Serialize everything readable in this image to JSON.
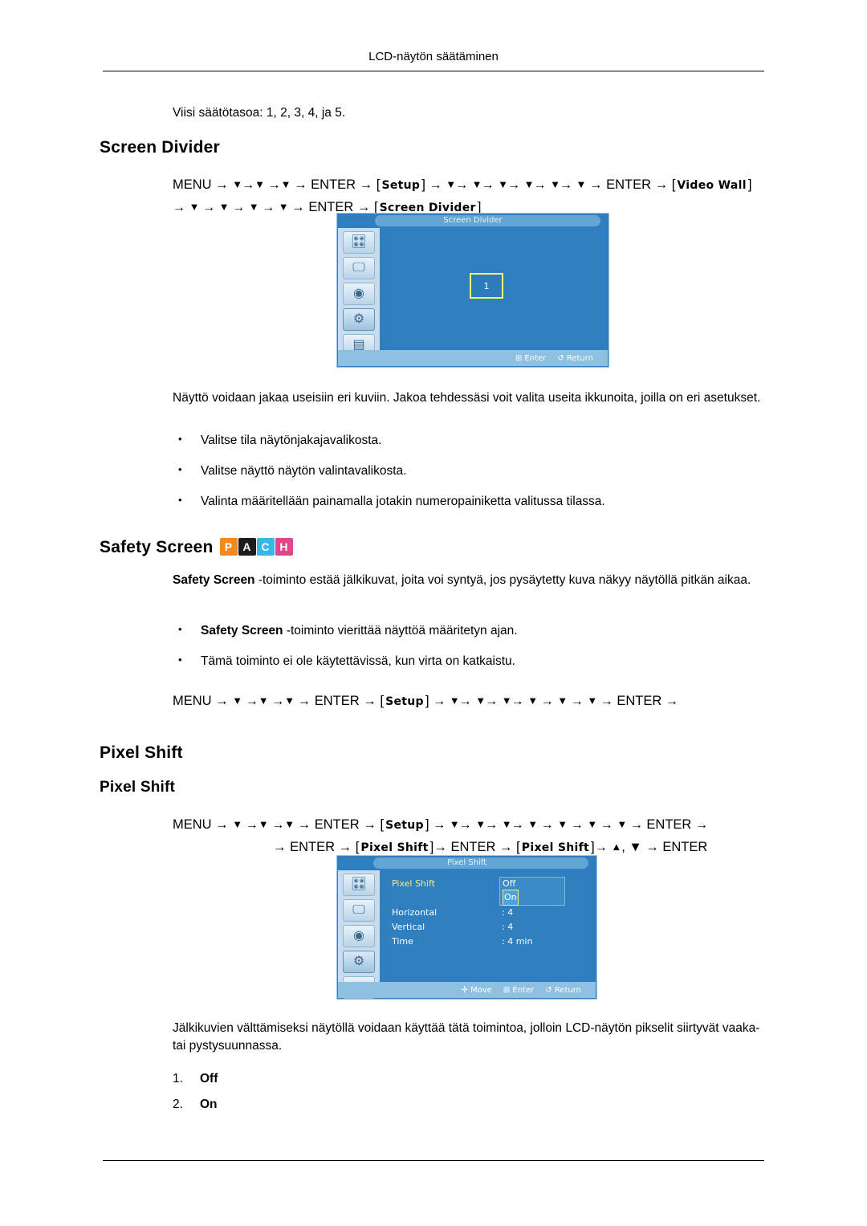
{
  "header": {
    "title": "LCD-näytön säätäminen"
  },
  "intro_line": "Viisi säätötasoa: 1, 2, 3, 4, ja 5.",
  "screen_divider": {
    "heading": "Screen Divider",
    "path_line1_a": "MENU →",
    "path_line1_b": "→",
    "path_line1_c": "→",
    "path_line1_d": "→ ENTER →",
    "setup_label": "Setup",
    "path_line1_e": "→",
    "path_line1_f": "→ ENTER →",
    "video_wall_label": "Video Wall",
    "path_line2_a": "→",
    "path_line2_b": "→ ENTER →",
    "screen_divider_label": "Screen Divider",
    "osd": {
      "title": "Screen Divider",
      "cell_label": "1",
      "footer_enter": "Enter",
      "footer_return": "Return"
    },
    "body": "Näyttö voidaan jakaa useisiin eri kuviin. Jakoa tehdessäsi voit valita useita ikkunoita, joilla on eri asetukset.",
    "bullets": [
      "Valitse tila näytönjakajavalikosta.",
      "Valitse näyttö näytön valintavalikosta.",
      "Valinta määritellään painamalla jotakin numeropainiketta valitussa tilassa."
    ]
  },
  "safety_screen": {
    "heading": "Safety Screen",
    "badges": [
      {
        "letter": "P",
        "color": "#f08a1e"
      },
      {
        "letter": "A",
        "color": "#1d1d1b"
      },
      {
        "letter": "C",
        "color": "#39b6e8"
      },
      {
        "letter": "H",
        "color": "#e2468a"
      }
    ],
    "body_bold": "Safety Screen",
    "body_rest": "-toiminto estää jälkikuvat, joita voi syntyä, jos pysäytetty kuva näkyy näytöllä pitkän aikaa.",
    "bullet1_bold": "Safety Screen",
    "bullet1_rest": "-toiminto vierittää näyttöä määritetyn ajan.",
    "bullet2": "Tämä toiminto ei ole käytettävissä, kun virta on katkaistu.",
    "path_a": "MENU →",
    "path_b": "→ ENTER →",
    "setup_label": "Setup",
    "path_c": "→",
    "path_d": "→ ENTER →"
  },
  "pixel_shift": {
    "heading": "Pixel Shift",
    "subheading": "Pixel Shift",
    "path_line1_a": "MENU →",
    "path_line1_b": "→ ENTER →",
    "setup_label": "Setup",
    "path_line1_c": "→",
    "path_line1_d": "→ ENTER →",
    "path_line2_a": "→ ENTER →",
    "pixel_shift_label1": "Pixel Shift",
    "path_line2_b": "→ ENTER →",
    "pixel_shift_label2": "Pixel Shift",
    "path_line2_c": "→",
    "path_line2_d": ", ▼ → ENTER",
    "osd": {
      "title": "Pixel Shift",
      "rows": [
        {
          "label": "Pixel Shift",
          "value": "",
          "highlight": true
        },
        {
          "label": "Horizontal",
          "value": ": 4",
          "highlight": false
        },
        {
          "label": "Vertical",
          "value": ": 4",
          "highlight": false
        },
        {
          "label": "Time",
          "value": ": 4 min",
          "highlight": false
        }
      ],
      "options": [
        "Off",
        "On"
      ],
      "selected_option": "On",
      "footer_move": "Move",
      "footer_enter": "Enter",
      "footer_return": "Return"
    },
    "body": "Jälkikuvien välttämiseksi näytöllä voidaan käyttää tätä toimintoa, jolloin LCD-näytön pikselit siirtyvät vaaka- tai pystysuunnassa.",
    "list": [
      {
        "num": "1.",
        "label": "Off"
      },
      {
        "num": "2.",
        "label": "On"
      }
    ]
  }
}
